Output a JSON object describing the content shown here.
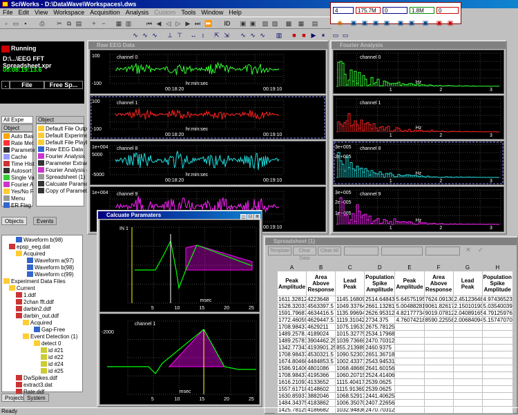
{
  "app": {
    "title": "SciWorks - D:\\DataWave\\Workspaces\\.dws",
    "status": "Ready"
  },
  "menu": [
    "File",
    "Edit",
    "View",
    "Workspace",
    "Acquisition",
    "Analysis",
    "Custom",
    "Tools",
    "Window",
    "Help"
  ],
  "status_boxes": [
    "4",
    "175.7M",
    "0",
    "1.8M",
    "0"
  ],
  "toolbar_id_label": "ID",
  "run_panel": {
    "state": "Running",
    "file": "D:\\...\\EEG FFT Spreadsheet.xpr",
    "time": "00:08:19:13.6",
    "cells": [
      ".",
      "File",
      "Free Sp..."
    ]
  },
  "object_panel": {
    "filter": "All Expe",
    "type_header": "Object Type",
    "object_header": "Object",
    "types": [
      "Auto Bas",
      "Rate Met",
      "Paramete",
      "Cache",
      "Time Hist",
      "Autosort",
      "Single Va",
      "Fourier A",
      "Yes/No F",
      "Menu",
      "ER Flag"
    ],
    "objects": [
      "Default File Output",
      "Default Experiment",
      "Default File Playback",
      "Raw EEG Data",
      "Fourier Analysis",
      "Parameter Extraction",
      "Fourier Analysis (1)",
      "Spreadsheet (1)",
      "Calcuate Paramaters",
      "Copy of Parameter"
    ],
    "tabs": [
      "Objects",
      "Events"
    ]
  },
  "project_tree": {
    "items": [
      "Waveform b(98)",
      "epsp_eeg.dat",
      "Acquired",
      "Waveform a(97)",
      "Waveform b(98)",
      "Waveform c(99)",
      "Experiment Data Files",
      "Current",
      "1.ddf",
      "2chan fft.ddf",
      "darbin2.ddf",
      "darbin_out.ddf",
      "Acquired",
      "Gap-Free",
      "Event Detection (1)",
      "detect 0",
      "id #21",
      "id #22",
      "id #24",
      "id #25",
      "DwSpikes.ddf",
      "extract3.dat",
      "Rate.ddf"
    ],
    "tabs": [
      "Projects",
      "System"
    ]
  },
  "eeg_window": {
    "title": "Raw EEG Data",
    "channels": [
      {
        "name": "channel 0",
        "top_label": "100",
        "bottom_label": "-100",
        "t0": "00:18:20",
        "t1": "00:19:10",
        "axis": "hr:min:sec",
        "color": "#33ff33"
      },
      {
        "name": "channel 1",
        "top_label": "100",
        "bottom_label": "-100",
        "t0": "00:18:20",
        "t1": "00:19:10",
        "axis": "hr:min:sec",
        "color": "#ff2020"
      },
      {
        "name": "channel 8",
        "top_label": "1e+004",
        "bottom_label": "-5000",
        "mid_label": "5000",
        "t0": "00:18:20",
        "t1": "00:19:10",
        "axis": "hr:min:sec",
        "color": "#20e0e0"
      },
      {
        "name": "channel 9",
        "top_label": "1e+004",
        "bottom_label": "",
        "t0": "00:18:20",
        "t1": "00:19:10",
        "axis": "",
        "color": "#ff20ff"
      }
    ]
  },
  "fourier_window": {
    "title": "Fourier Analysis",
    "axis": "Hz",
    "channels": [
      {
        "name": "channel 0",
        "color": "#33ff33",
        "ticks": [
          "1",
          "2",
          "3"
        ]
      },
      {
        "name": "channel 1",
        "color": "#ff2020",
        "ticks": [
          "1",
          "2",
          "3"
        ]
      },
      {
        "name": "channel 8",
        "color": "#20e0e0",
        "top_label": "3e+005",
        "mid_label": "2e+005",
        "ticks": [
          "1",
          "2",
          "3"
        ]
      },
      {
        "name": "channel 9",
        "color": "#ff20ff",
        "top_label": "3e+005",
        "mid_label": "2e+005",
        "low_label": "1e+005",
        "ticks": [
          "1",
          "2",
          "3"
        ]
      }
    ]
  },
  "calc_window": {
    "title": "Calcuate Paramaters",
    "channel0_label": "IN 1",
    "channel1_label": "channel 1",
    "ylabel2": "-2000",
    "axis": "msec",
    "ticks": [
      "5",
      "10",
      "15",
      "20",
      "25"
    ]
  },
  "spreadsheet": {
    "title": "Spreadsheet (1)",
    "buttons": [
      "Template",
      "Clear Data",
      "Clear All"
    ],
    "cols": [
      "A",
      "B",
      "C",
      "D",
      "E",
      "F",
      "G",
      "H"
    ],
    "headers": [
      "Peak Amplitude",
      "Area Above Response",
      "Lead Peak",
      "Population Spike Amplitude",
      "Peak Amplitude",
      "Area Above Response",
      "Lead Peak",
      "Population Spike Amplitude"
    ],
    "rows": [
      [
        "1611.328125",
        "4223648",
        "1145.16809...",
        "2514.64843...",
        "5.64575195...",
        "7624.09130...",
        "2.45123648...",
        "4.97436523..."
      ],
      [
        "1528.32031...",
        "4563397.5",
        "1049.33764...",
        "2661.13281...",
        "5.00488281...",
        "9061.82617...",
        "2.15010190...",
        "5.03540039..."
      ],
      [
        "1591.796875",
        "4634416.5",
        "1135.99694...",
        "2626.953125",
        "4.82177734...",
        "9019.078125",
        "2.04089165...",
        "4.79125976..."
      ],
      [
        "1772.460593...",
        "4629447.5",
        "1119.31042...",
        "2734.375",
        "4.76074218...",
        "8590.22558...",
        "2.00684094...",
        "5.15747070..."
      ],
      [
        "1708.984375",
        "4629211",
        "1075.19531...",
        "2675.78125",
        "",
        "",
        "",
        ""
      ],
      [
        "1489.2578...",
        "4189024",
        "1015.32775...",
        "2534.17968...",
        "",
        "",
        "",
        ""
      ],
      [
        "1489.25781",
        "3904462.25",
        "1039.73669...",
        "2470.703125",
        "",
        "",
        "",
        ""
      ],
      [
        "1342.77343...",
        "4193901.25",
        "855.213989...",
        "2460.9375",
        "",
        "",
        "",
        ""
      ],
      [
        "1708.984375",
        "4530321.5",
        "1090.52307...",
        "2651.36718...",
        "",
        "",
        "",
        ""
      ],
      [
        "1674.80468...",
        "4484853.5",
        "1002.43371...",
        "2543.94531...",
        "",
        "",
        "",
        ""
      ],
      [
        "1586.91406...",
        "4801086",
        "1068.48669...",
        "2641.60156...",
        "",
        "",
        "",
        ""
      ],
      [
        "1708.984375",
        "4195366",
        "1060.20715...",
        "2524.41406...",
        "",
        "",
        "",
        ""
      ],
      [
        "1616.21093...",
        "4133652",
        "1115.40417...",
        "2539.0625",
        "",
        "",
        "",
        ""
      ],
      [
        "1557.61718...",
        "4148602",
        "1115.91369...",
        "2539.0625",
        "",
        "",
        "",
        ""
      ],
      [
        "1630.859375",
        "3882046",
        "1068.52917...",
        "2441.40625",
        "",
        "",
        "",
        ""
      ],
      [
        "1484.34375",
        "4183862",
        "1006.35070...",
        "2407.22656...",
        "",
        "",
        "",
        ""
      ],
      [
        "1425.78125",
        "4186682",
        "1032.94836...",
        "2470.703125",
        "",
        "",
        "",
        ""
      ]
    ]
  }
}
